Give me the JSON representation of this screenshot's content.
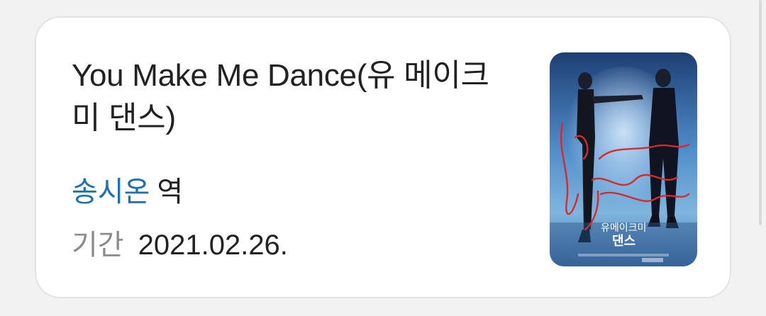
{
  "card": {
    "title": "You Make Me Dance(유 메이크 미 댄스)",
    "actor": "송시온",
    "role_suffix": "역",
    "period_label": "기간",
    "period_value": "2021.02.26.",
    "poster": {
      "script_text": "You make me Dance",
      "logo_text": "유메이크미 댄스"
    }
  },
  "colors": {
    "actor_link": "#1a6fb8",
    "text": "#222222",
    "label": "#8c8c8c",
    "poster_script": "#d42b2b"
  }
}
